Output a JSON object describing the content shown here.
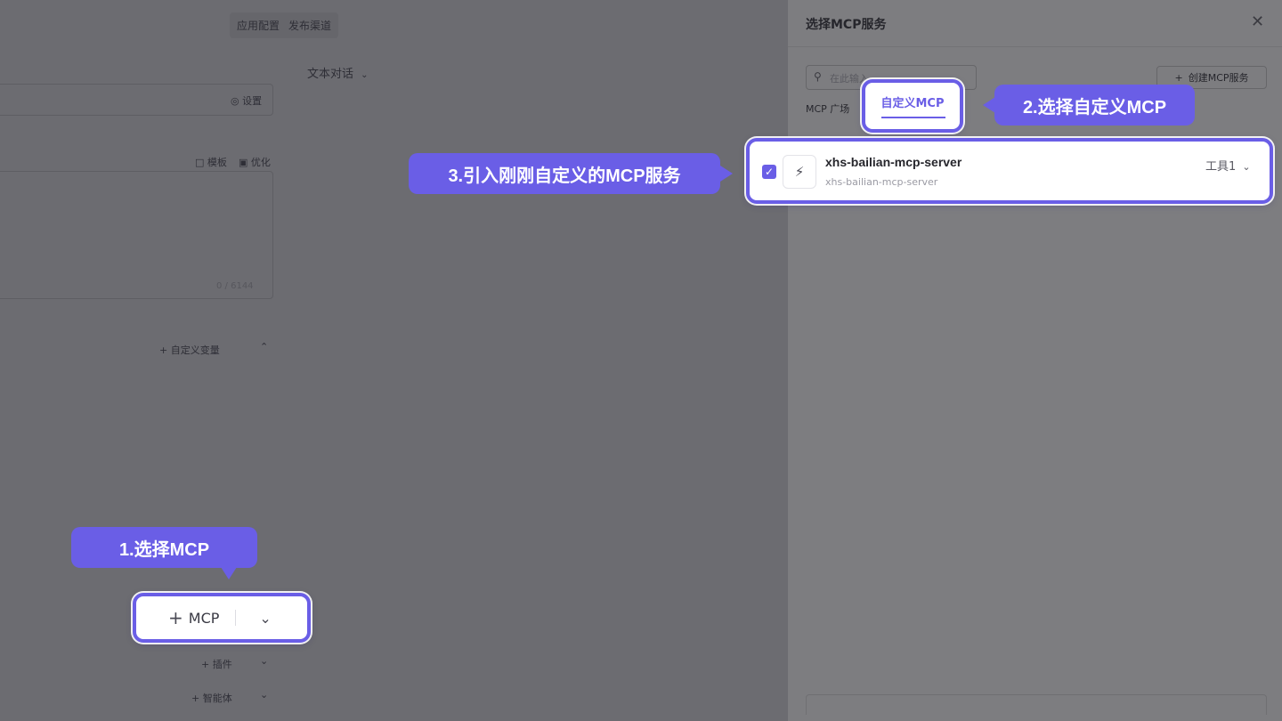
{
  "background_app": {
    "tabs": [
      "应用配置",
      "发布渠道"
    ],
    "mode_label": "文本对话",
    "settings_label": "设置",
    "template_label": "模板",
    "optimize_label": "优化",
    "char_count": "0 / 6144",
    "custom_var_label": "自定义变量",
    "plugin_label": "插件",
    "agent_label": "智能体"
  },
  "drawer": {
    "title": "选择MCP服务",
    "search_placeholder": "在此输入",
    "create_button": "创建MCP服务",
    "tabs": [
      {
        "label": "MCP 广场",
        "active": false
      },
      {
        "label": "自定义MCP",
        "active": true
      }
    ],
    "server": {
      "name": "xhs-bailian-mcp-server",
      "subtitle": "xhs-bailian-mcp-server",
      "checked": true,
      "tools_label": "工具1"
    }
  },
  "mcp_button": {
    "label": "MCP"
  },
  "callouts": {
    "step1": "1.选择MCP",
    "step2": "2.选择自定义MCP",
    "step3": "3.引入刚刚自定义的MCP服务"
  },
  "colors": {
    "accent": "#6a5ee6",
    "overlay": "#6f6f74",
    "drawer_bg": "#7d7d80"
  }
}
